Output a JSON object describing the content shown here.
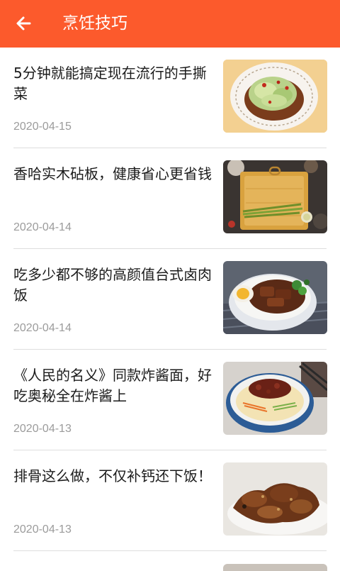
{
  "header": {
    "title": "烹饪技巧",
    "back_icon": "arrow-left-icon",
    "background_color": "#fc5a2c"
  },
  "articles": [
    {
      "title": "5分钟就能搞定现在流行的手撕菜",
      "date": "2020-04-15",
      "image": "hand-torn-cabbage-dish"
    },
    {
      "title": "香哈实木砧板，健康省心更省钱",
      "date": "2020-04-14",
      "image": "wooden-cutting-board-with-asparagus"
    },
    {
      "title": "吃多少都不够的高颜值台式卤肉饭",
      "date": "2020-04-14",
      "image": "taiwanese-braised-pork-rice"
    },
    {
      "title": "《人民的名义》同款炸酱面，好吃奥秘全在炸酱上",
      "date": "2020-04-13",
      "image": "zhajiang-noodles-bowl"
    },
    {
      "title": "排骨这么做，不仅补钙还下饭！",
      "date": "2020-04-13",
      "image": "braised-spare-ribs"
    }
  ]
}
